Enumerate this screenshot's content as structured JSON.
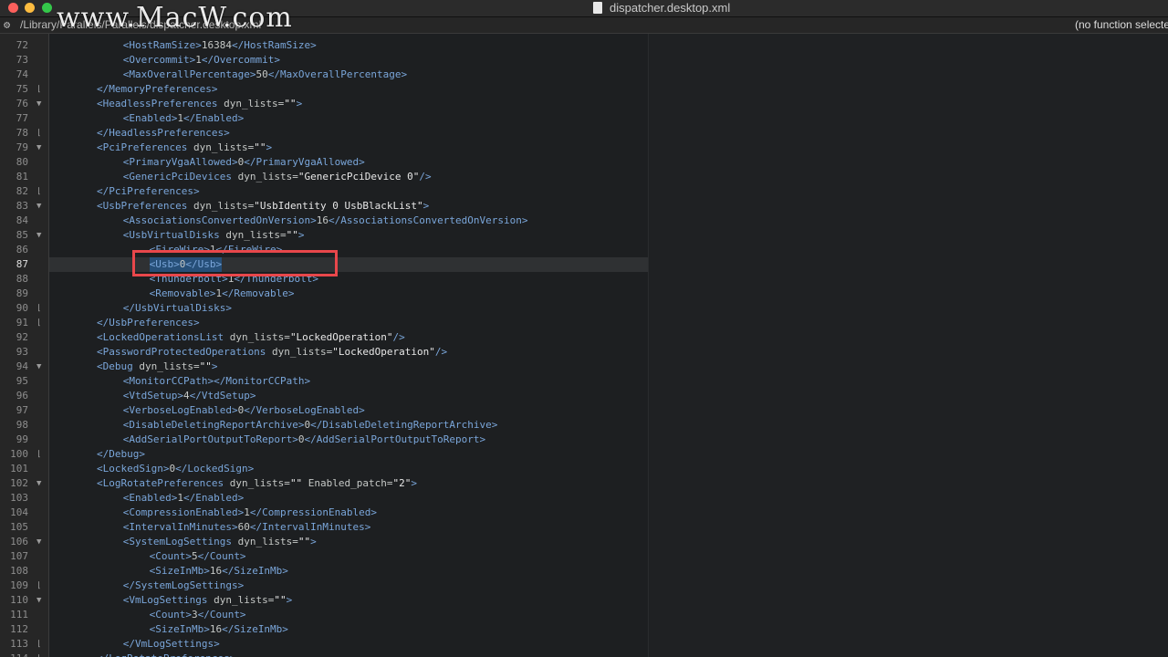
{
  "window": {
    "title": "dispatcher.desktop.xml"
  },
  "watermark": "www.MacW.com",
  "pathbar": {
    "path": "/Library/Parallels/Parallels/dispatcher.desktop.xml",
    "function_selector": "(no function selected)"
  },
  "editor": {
    "first_line": 72,
    "active_line": 87,
    "selection_line": 87,
    "lines": [
      {
        "n": 72,
        "indent": 4,
        "parts": [
          {
            "k": "t",
            "v": "<HostRamSize>"
          },
          {
            "k": "tx",
            "v": "16384"
          },
          {
            "k": "t",
            "v": "</HostRamSize>"
          }
        ]
      },
      {
        "n": 73,
        "indent": 4,
        "parts": [
          {
            "k": "t",
            "v": "<Overcommit>"
          },
          {
            "k": "tx",
            "v": "1"
          },
          {
            "k": "t",
            "v": "</Overcommit>"
          }
        ]
      },
      {
        "n": 74,
        "indent": 4,
        "parts": [
          {
            "k": "t",
            "v": "<MaxOverallPercentage>"
          },
          {
            "k": "tx",
            "v": "50"
          },
          {
            "k": "t",
            "v": "</MaxOverallPercentage>"
          }
        ]
      },
      {
        "n": 75,
        "indent": 2,
        "fold": "end",
        "parts": [
          {
            "k": "t",
            "v": "</MemoryPreferences>"
          }
        ]
      },
      {
        "n": 76,
        "indent": 2,
        "fold": "start",
        "parts": [
          {
            "k": "t",
            "v": "<HeadlessPreferences"
          },
          {
            "k": "an",
            "v": " dyn_lists="
          },
          {
            "k": "av",
            "v": "\"\""
          },
          {
            "k": "t",
            "v": ">"
          }
        ]
      },
      {
        "n": 77,
        "indent": 4,
        "parts": [
          {
            "k": "t",
            "v": "<Enabled>"
          },
          {
            "k": "tx",
            "v": "1"
          },
          {
            "k": "t",
            "v": "</Enabled>"
          }
        ]
      },
      {
        "n": 78,
        "indent": 2,
        "fold": "end",
        "parts": [
          {
            "k": "t",
            "v": "</HeadlessPreferences>"
          }
        ]
      },
      {
        "n": 79,
        "indent": 2,
        "fold": "start",
        "parts": [
          {
            "k": "t",
            "v": "<PciPreferences"
          },
          {
            "k": "an",
            "v": " dyn_lists="
          },
          {
            "k": "av",
            "v": "\"\""
          },
          {
            "k": "t",
            "v": ">"
          }
        ]
      },
      {
        "n": 80,
        "indent": 4,
        "parts": [
          {
            "k": "t",
            "v": "<PrimaryVgaAllowed>"
          },
          {
            "k": "tx",
            "v": "0"
          },
          {
            "k": "t",
            "v": "</PrimaryVgaAllowed>"
          }
        ]
      },
      {
        "n": 81,
        "indent": 4,
        "parts": [
          {
            "k": "t",
            "v": "<GenericPciDevices"
          },
          {
            "k": "an",
            "v": " dyn_lists="
          },
          {
            "k": "av",
            "v": "\"GenericPciDevice 0\""
          },
          {
            "k": "t",
            "v": "/>"
          }
        ]
      },
      {
        "n": 82,
        "indent": 2,
        "fold": "end",
        "parts": [
          {
            "k": "t",
            "v": "</PciPreferences>"
          }
        ]
      },
      {
        "n": 83,
        "indent": 2,
        "fold": "start",
        "parts": [
          {
            "k": "t",
            "v": "<UsbPreferences"
          },
          {
            "k": "an",
            "v": " dyn_lists="
          },
          {
            "k": "av",
            "v": "\"UsbIdentity 0 UsbBlackList\""
          },
          {
            "k": "t",
            "v": ">"
          }
        ]
      },
      {
        "n": 84,
        "indent": 4,
        "parts": [
          {
            "k": "t",
            "v": "<AssociationsConvertedOnVersion>"
          },
          {
            "k": "tx",
            "v": "16"
          },
          {
            "k": "t",
            "v": "</AssociationsConvertedOnVersion>"
          }
        ]
      },
      {
        "n": 85,
        "indent": 4,
        "fold": "start",
        "parts": [
          {
            "k": "t",
            "v": "<UsbVirtualDisks"
          },
          {
            "k": "an",
            "v": " dyn_lists="
          },
          {
            "k": "av",
            "v": "\"\""
          },
          {
            "k": "t",
            "v": ">"
          }
        ]
      },
      {
        "n": 86,
        "indent": 6,
        "parts": [
          {
            "k": "t",
            "v": "<FireWire>"
          },
          {
            "k": "tx",
            "v": "1"
          },
          {
            "k": "t",
            "v": "</FireWire>"
          }
        ]
      },
      {
        "n": 87,
        "indent": 6,
        "parts": [
          {
            "k": "t",
            "v": "<Usb>"
          },
          {
            "k": "tx",
            "v": "0"
          },
          {
            "k": "t",
            "v": "</Usb>"
          }
        ]
      },
      {
        "n": 88,
        "indent": 6,
        "parts": [
          {
            "k": "t",
            "v": "<Thunderbolt>"
          },
          {
            "k": "tx",
            "v": "1"
          },
          {
            "k": "t",
            "v": "</Thunderbolt>"
          }
        ]
      },
      {
        "n": 89,
        "indent": 6,
        "parts": [
          {
            "k": "t",
            "v": "<Removable>"
          },
          {
            "k": "tx",
            "v": "1"
          },
          {
            "k": "t",
            "v": "</Removable>"
          }
        ]
      },
      {
        "n": 90,
        "indent": 4,
        "fold": "end",
        "parts": [
          {
            "k": "t",
            "v": "</UsbVirtualDisks>"
          }
        ]
      },
      {
        "n": 91,
        "indent": 2,
        "fold": "end",
        "parts": [
          {
            "k": "t",
            "v": "</UsbPreferences>"
          }
        ]
      },
      {
        "n": 92,
        "indent": 2,
        "parts": [
          {
            "k": "t",
            "v": "<LockedOperationsList"
          },
          {
            "k": "an",
            "v": " dyn_lists="
          },
          {
            "k": "av",
            "v": "\"LockedOperation\""
          },
          {
            "k": "t",
            "v": "/>"
          }
        ]
      },
      {
        "n": 93,
        "indent": 2,
        "parts": [
          {
            "k": "t",
            "v": "<PasswordProtectedOperations"
          },
          {
            "k": "an",
            "v": " dyn_lists="
          },
          {
            "k": "av",
            "v": "\"LockedOperation\""
          },
          {
            "k": "t",
            "v": "/>"
          }
        ]
      },
      {
        "n": 94,
        "indent": 2,
        "fold": "start",
        "parts": [
          {
            "k": "t",
            "v": "<Debug"
          },
          {
            "k": "an",
            "v": " dyn_lists="
          },
          {
            "k": "av",
            "v": "\"\""
          },
          {
            "k": "t",
            "v": ">"
          }
        ]
      },
      {
        "n": 95,
        "indent": 4,
        "parts": [
          {
            "k": "t",
            "v": "<MonitorCCPath></MonitorCCPath>"
          }
        ]
      },
      {
        "n": 96,
        "indent": 4,
        "parts": [
          {
            "k": "t",
            "v": "<VtdSetup>"
          },
          {
            "k": "tx",
            "v": "4"
          },
          {
            "k": "t",
            "v": "</VtdSetup>"
          }
        ]
      },
      {
        "n": 97,
        "indent": 4,
        "parts": [
          {
            "k": "t",
            "v": "<VerboseLogEnabled>"
          },
          {
            "k": "tx",
            "v": "0"
          },
          {
            "k": "t",
            "v": "</VerboseLogEnabled>"
          }
        ]
      },
      {
        "n": 98,
        "indent": 4,
        "parts": [
          {
            "k": "t",
            "v": "<DisableDeletingReportArchive>"
          },
          {
            "k": "tx",
            "v": "0"
          },
          {
            "k": "t",
            "v": "</DisableDeletingReportArchive>"
          }
        ]
      },
      {
        "n": 99,
        "indent": 4,
        "parts": [
          {
            "k": "t",
            "v": "<AddSerialPortOutputToReport>"
          },
          {
            "k": "tx",
            "v": "0"
          },
          {
            "k": "t",
            "v": "</AddSerialPortOutputToReport>"
          }
        ]
      },
      {
        "n": 100,
        "indent": 2,
        "fold": "end",
        "parts": [
          {
            "k": "t",
            "v": "</Debug>"
          }
        ]
      },
      {
        "n": 101,
        "indent": 2,
        "parts": [
          {
            "k": "t",
            "v": "<LockedSign>"
          },
          {
            "k": "tx",
            "v": "0"
          },
          {
            "k": "t",
            "v": "</LockedSign>"
          }
        ]
      },
      {
        "n": 102,
        "indent": 2,
        "fold": "start",
        "parts": [
          {
            "k": "t",
            "v": "<LogRotatePreferences"
          },
          {
            "k": "an",
            "v": " dyn_lists="
          },
          {
            "k": "av",
            "v": "\"\""
          },
          {
            "k": "an",
            "v": " Enabled_patch="
          },
          {
            "k": "av",
            "v": "\"2\""
          },
          {
            "k": "t",
            "v": ">"
          }
        ]
      },
      {
        "n": 103,
        "indent": 4,
        "parts": [
          {
            "k": "t",
            "v": "<Enabled>"
          },
          {
            "k": "tx",
            "v": "1"
          },
          {
            "k": "t",
            "v": "</Enabled>"
          }
        ]
      },
      {
        "n": 104,
        "indent": 4,
        "parts": [
          {
            "k": "t",
            "v": "<CompressionEnabled>"
          },
          {
            "k": "tx",
            "v": "1"
          },
          {
            "k": "t",
            "v": "</CompressionEnabled>"
          }
        ]
      },
      {
        "n": 105,
        "indent": 4,
        "parts": [
          {
            "k": "t",
            "v": "<IntervalInMinutes>"
          },
          {
            "k": "tx",
            "v": "60"
          },
          {
            "k": "t",
            "v": "</IntervalInMinutes>"
          }
        ]
      },
      {
        "n": 106,
        "indent": 4,
        "fold": "start",
        "parts": [
          {
            "k": "t",
            "v": "<SystemLogSettings"
          },
          {
            "k": "an",
            "v": " dyn_lists="
          },
          {
            "k": "av",
            "v": "\"\""
          },
          {
            "k": "t",
            "v": ">"
          }
        ]
      },
      {
        "n": 107,
        "indent": 6,
        "parts": [
          {
            "k": "t",
            "v": "<Count>"
          },
          {
            "k": "tx",
            "v": "5"
          },
          {
            "k": "t",
            "v": "</Count>"
          }
        ]
      },
      {
        "n": 108,
        "indent": 6,
        "parts": [
          {
            "k": "t",
            "v": "<SizeInMb>"
          },
          {
            "k": "tx",
            "v": "16"
          },
          {
            "k": "t",
            "v": "</SizeInMb>"
          }
        ]
      },
      {
        "n": 109,
        "indent": 4,
        "fold": "end",
        "parts": [
          {
            "k": "t",
            "v": "</SystemLogSettings>"
          }
        ]
      },
      {
        "n": 110,
        "indent": 4,
        "fold": "start",
        "parts": [
          {
            "k": "t",
            "v": "<VmLogSettings"
          },
          {
            "k": "an",
            "v": " dyn_lists="
          },
          {
            "k": "av",
            "v": "\"\""
          },
          {
            "k": "t",
            "v": ">"
          }
        ]
      },
      {
        "n": 111,
        "indent": 6,
        "parts": [
          {
            "k": "t",
            "v": "<Count>"
          },
          {
            "k": "tx",
            "v": "3"
          },
          {
            "k": "t",
            "v": "</Count>"
          }
        ]
      },
      {
        "n": 112,
        "indent": 6,
        "parts": [
          {
            "k": "t",
            "v": "<SizeInMb>"
          },
          {
            "k": "tx",
            "v": "16"
          },
          {
            "k": "t",
            "v": "</SizeInMb>"
          }
        ]
      },
      {
        "n": 113,
        "indent": 4,
        "fold": "end",
        "parts": [
          {
            "k": "t",
            "v": "</VmLogSettings>"
          }
        ]
      },
      {
        "n": 114,
        "indent": 2,
        "fold": "end",
        "parts": [
          {
            "k": "t",
            "v": "</LogRotatePreferences>"
          }
        ]
      }
    ]
  },
  "icons": {
    "gear": "gear-icon",
    "document": "document-icon",
    "fold_start": "fold-open-icon",
    "fold_end": "fold-end-icon"
  }
}
